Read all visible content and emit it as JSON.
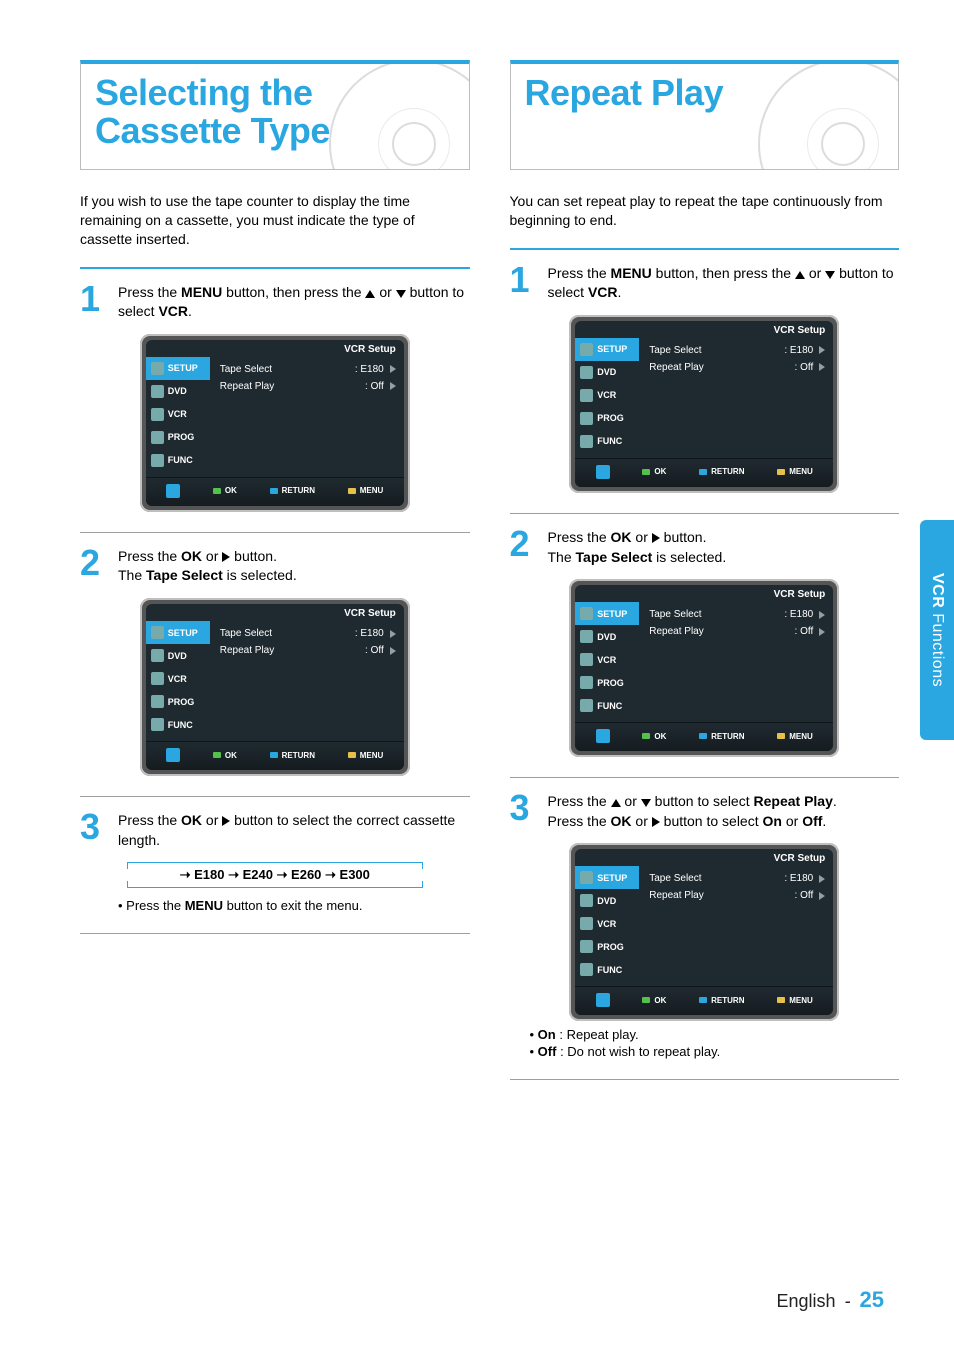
{
  "page": {
    "language": "English",
    "number": "25"
  },
  "side_tab": {
    "thin": "VCR ",
    "bold": "Functions"
  },
  "left": {
    "title": "Selecting the Cassette Type",
    "intro": "If you wish to use the tape counter to display the time remaining on a cassette, you must indicate the type of cassette inserted.",
    "steps": {
      "s1": {
        "num": "1",
        "a": "Press the ",
        "menu": "MENU",
        "b": " button, then press the ",
        "c": " or ",
        "d": " button to select ",
        "vcr": "VCR",
        "e": "."
      },
      "s2": {
        "num": "2",
        "a": "Press the ",
        "ok": "OK",
        "b": " or ",
        "c": " button.",
        "d": "The ",
        "ts": "Tape Select",
        "e": " is selected."
      },
      "s3": {
        "num": "3",
        "a": "Press the ",
        "ok": "OK",
        "b": " or ",
        "c": " button to select the correct cassette length."
      }
    },
    "flow": "➝ E180 ➝ E240 ➝ E260 ➝ E300",
    "exit_note_a": "• Press the ",
    "exit_note_b": "MENU",
    "exit_note_c": " button to exit the menu."
  },
  "right": {
    "title": "Repeat Play",
    "intro": "You can set repeat play to repeat the tape continuously from beginning to end.",
    "steps": {
      "s1": {
        "num": "1",
        "a": "Press the ",
        "menu": "MENU",
        "b": " button, then press the ",
        "c": " or ",
        "d": " button to select ",
        "vcr": "VCR",
        "e": "."
      },
      "s2": {
        "num": "2",
        "a": "Press the ",
        "ok": "OK",
        "b": " or ",
        "c": " button.",
        "d": "The ",
        "ts": "Tape Select",
        "e": " is selected."
      },
      "s3": {
        "num": "3",
        "a": "Press the ",
        "b": " or ",
        "c": " button to select ",
        "rp": "Repeat Play",
        "d": ".",
        "e": "Press the ",
        "ok": "OK",
        "f": " or ",
        "g": " button to select ",
        "on": "On",
        "h": " or ",
        "off": "Off",
        "i": "."
      }
    },
    "bullets": {
      "on_a": "• ",
      "on_b": "On",
      "on_c": " : Repeat play.",
      "off_a": "• ",
      "off_b": "Off",
      "off_c": " : Do not wish to repeat play."
    }
  },
  "osd": {
    "title": "VCR Setup",
    "tabs": [
      "SETUP",
      "DVD",
      "VCR",
      "PROG",
      "FUNC"
    ],
    "rows": [
      {
        "label": "Tape Select",
        "value": ": E180"
      },
      {
        "label": "Repeat Play",
        "value": ": Off"
      }
    ],
    "foot": [
      "OK",
      "RETURN",
      "MENU"
    ]
  }
}
